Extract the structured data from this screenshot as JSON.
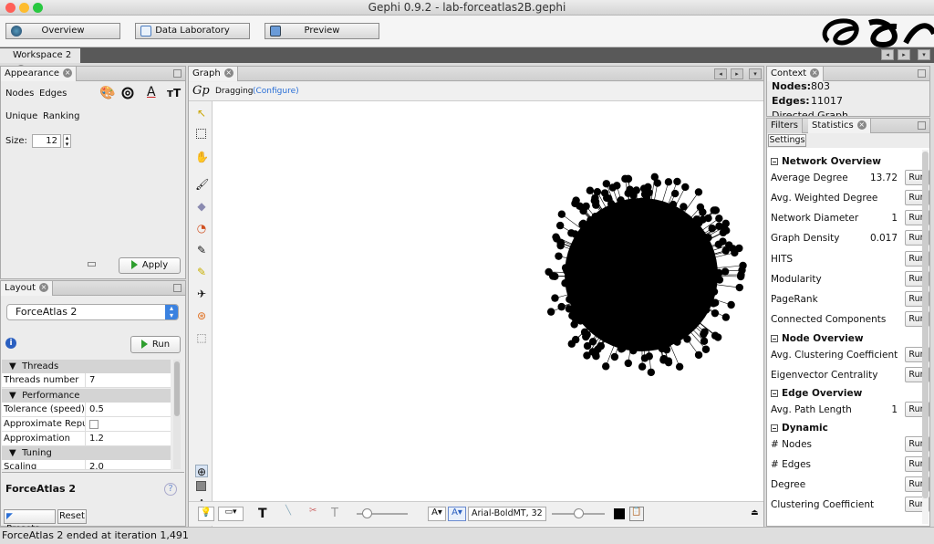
{
  "window": {
    "title": "Gephi 0.9.2 - lab-forceatlas2B.gephi"
  },
  "toolbar": {
    "overview": "Overview",
    "data_laboratory": "Data Laboratory",
    "preview": "Preview"
  },
  "workspace_tab": {
    "label": "Workspace 2"
  },
  "appearance": {
    "title": "Appearance",
    "tabs": [
      "Nodes",
      "Edges"
    ],
    "modes": [
      "Unique",
      "Ranking"
    ],
    "size_label": "Size:",
    "size_value": "12",
    "apply": "Apply"
  },
  "layout": {
    "title": "Layout",
    "algorithm": "ForceAtlas 2",
    "run": "Run",
    "sections": {
      "threads": "Threads",
      "performance": "Performance",
      "tuning": "Tuning"
    },
    "properties": {
      "threads_number": {
        "label": "Threads number",
        "value": "7"
      },
      "tolerance": {
        "label": "Tolerance (speed)",
        "value": "0.5"
      },
      "approx_repulsion": {
        "label": "Approximate Repu",
        "value": ""
      },
      "approximation": {
        "label": "Approximation",
        "value": "1.2"
      },
      "scaling": {
        "label": "Scaling",
        "value": "2.0"
      }
    },
    "description_title": "ForceAtlas 2",
    "help": "?",
    "presets": "Presets...",
    "reset": "Reset"
  },
  "graph": {
    "title": "Graph",
    "mode": "Dragging",
    "configure": "(Configure)",
    "font_label": "Arial-BoldMT, 32",
    "node_count": 803
  },
  "context": {
    "title": "Context",
    "nodes_label": "Nodes:",
    "nodes_value": "803",
    "edges_label": "Edges:",
    "edges_value": "11017",
    "graph_type": "Directed Graph"
  },
  "statistics": {
    "tabs": [
      "Filters",
      "Statistics"
    ],
    "settings": "Settings",
    "run_label": "Run",
    "groups": [
      {
        "title": "Network Overview",
        "rows": [
          {
            "name": "Average Degree",
            "value": "13.72"
          },
          {
            "name": "Avg. Weighted Degree",
            "value": ""
          },
          {
            "name": "Network Diameter",
            "value": "1"
          },
          {
            "name": "Graph Density",
            "value": "0.017"
          },
          {
            "name": "HITS",
            "value": ""
          },
          {
            "name": "Modularity",
            "value": ""
          },
          {
            "name": "PageRank",
            "value": ""
          },
          {
            "name": "Connected Components",
            "value": ""
          }
        ]
      },
      {
        "title": "Node Overview",
        "rows": [
          {
            "name": "Avg. Clustering Coefficient",
            "value": ""
          },
          {
            "name": "Eigenvector Centrality",
            "value": ""
          }
        ]
      },
      {
        "title": "Edge Overview",
        "rows": [
          {
            "name": "Avg. Path Length",
            "value": "1"
          }
        ]
      },
      {
        "title": "Dynamic",
        "rows": [
          {
            "name": "# Nodes",
            "value": ""
          },
          {
            "name": "# Edges",
            "value": ""
          },
          {
            "name": "Degree",
            "value": ""
          },
          {
            "name": "Clustering Coefficient",
            "value": ""
          }
        ]
      }
    ]
  },
  "status": {
    "message": "ForceAtlas 2 ended at iteration 1,491"
  },
  "colors": {
    "accent": "#2a6fd6",
    "run_green": "#2e9e2e",
    "node": "#000000"
  }
}
